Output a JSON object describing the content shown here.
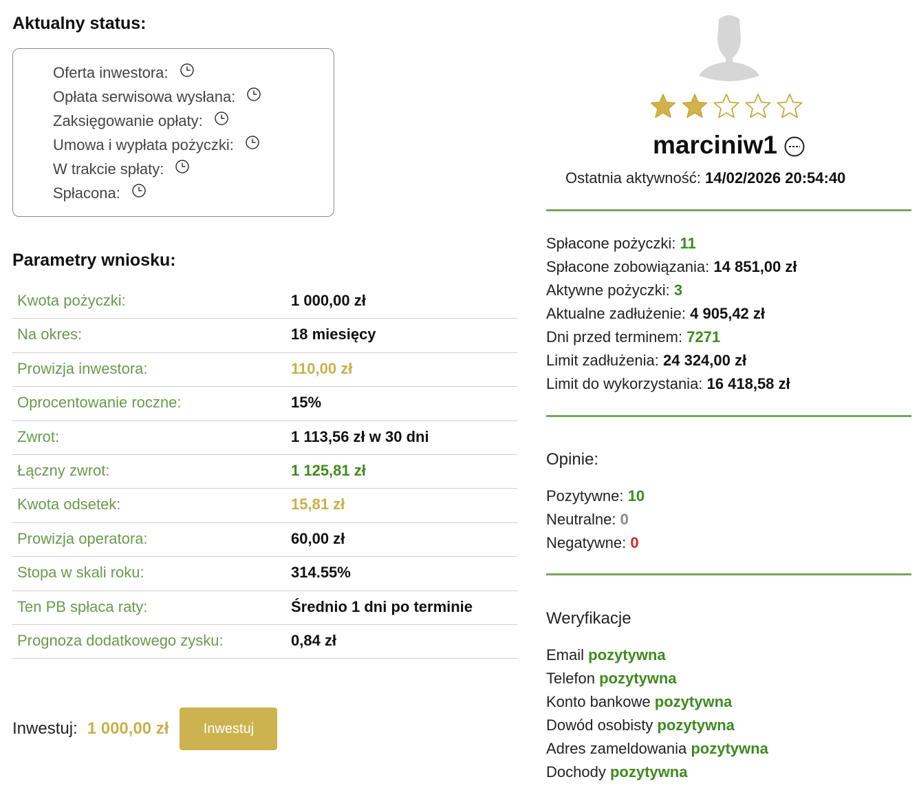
{
  "status": {
    "title": "Aktualny status:",
    "items": [
      {
        "label": "Oferta inwestora:"
      },
      {
        "label": "Opłata serwisowa wysłana:"
      },
      {
        "label": "Zaksięgowanie opłaty:"
      },
      {
        "label": "Umowa i wypłata pożyczki:"
      },
      {
        "label": "W trakcie spłaty:"
      },
      {
        "label": "Spłacona:"
      }
    ]
  },
  "params": {
    "title": "Parametry wniosku:",
    "rows": [
      {
        "label": "Kwota pożyczki:",
        "value": "1 000,00 zł",
        "color": "#111111"
      },
      {
        "label": "Na okres:",
        "value": "18 miesięcy",
        "color": "#111111"
      },
      {
        "label": "Prowizja inwestora:",
        "value": "110,00 zł",
        "color": "#c9b04b"
      },
      {
        "label": "Oprocentowanie roczne:",
        "value": "15%",
        "color": "#111111"
      },
      {
        "label": "Zwrot:",
        "value": "1 113,56 zł w 30 dni",
        "color": "#111111"
      },
      {
        "label": "Łączny zwrot:",
        "value": "1 125,81 zł",
        "color": "#3e8a1e"
      },
      {
        "label": "Kwota odsetek:",
        "value": "15,81 zł",
        "color": "#c9b04b"
      },
      {
        "label": "Prowizja operatora:",
        "value": "60,00 zł",
        "color": "#111111"
      },
      {
        "label": "Stopa w skali roku:",
        "value": "314.55%",
        "color": "#111111"
      },
      {
        "label": "Ten PB spłaca raty:",
        "value": "Średnio 1 dni po terminie",
        "color": "#111111"
      },
      {
        "label": "Prognoza dodatkowego zysku:",
        "value": "0,84 zł",
        "color": "#111111"
      }
    ]
  },
  "invest": {
    "label": "Inwestuj:",
    "amount": "1 000,00 zł",
    "button": "Inwestuj"
  },
  "profile": {
    "username": "marciniw1",
    "rating": 2,
    "rating_max": 5,
    "activity_label": "Ostatnia aktywność:",
    "activity_value": "14/02/2026 20:54:40"
  },
  "stats": {
    "repaid_loans_label": "Spłacone pożyczki:",
    "repaid_loans": "11",
    "repaid_liabilities_label": "Spłacone zobowiązania:",
    "repaid_liabilities": "14 851,00 zł",
    "active_loans_label": "Aktywne pożyczki:",
    "active_loans": "3",
    "current_debt_label": "Aktualne zadłużenie:",
    "current_debt": "4 905,42 zł",
    "days_before_label": "Dni przed terminem:",
    "days_before": "7271",
    "debt_limit_label": "Limit zadłużenia:",
    "debt_limit": "24 324,00 zł",
    "available_limit_label": "Limit do wykorzystania:",
    "available_limit": "16 418,58 zł"
  },
  "opinions": {
    "title": "Opinie:",
    "positive_label": "Pozytywne:",
    "positive": "10",
    "neutral_label": "Neutralne:",
    "neutral": "0",
    "negative_label": "Negatywne:",
    "negative": "0"
  },
  "verifications": {
    "title": "Weryfikacje",
    "items": [
      {
        "label": "Email",
        "status": "pozytywna"
      },
      {
        "label": "Telefon",
        "status": "pozytywna"
      },
      {
        "label": "Konto bankowe",
        "status": "pozytywna"
      },
      {
        "label": "Dowód osobisty",
        "status": "pozytywna"
      },
      {
        "label": "Adres zameldowania",
        "status": "pozytywna"
      },
      {
        "label": "Dochody",
        "status": "pozytywna"
      }
    ]
  },
  "colors": {
    "accent_green": "#3e8a1e",
    "label_green": "#6a9a4c",
    "gold": "#c9b04b",
    "divider": "#7ba35c"
  }
}
